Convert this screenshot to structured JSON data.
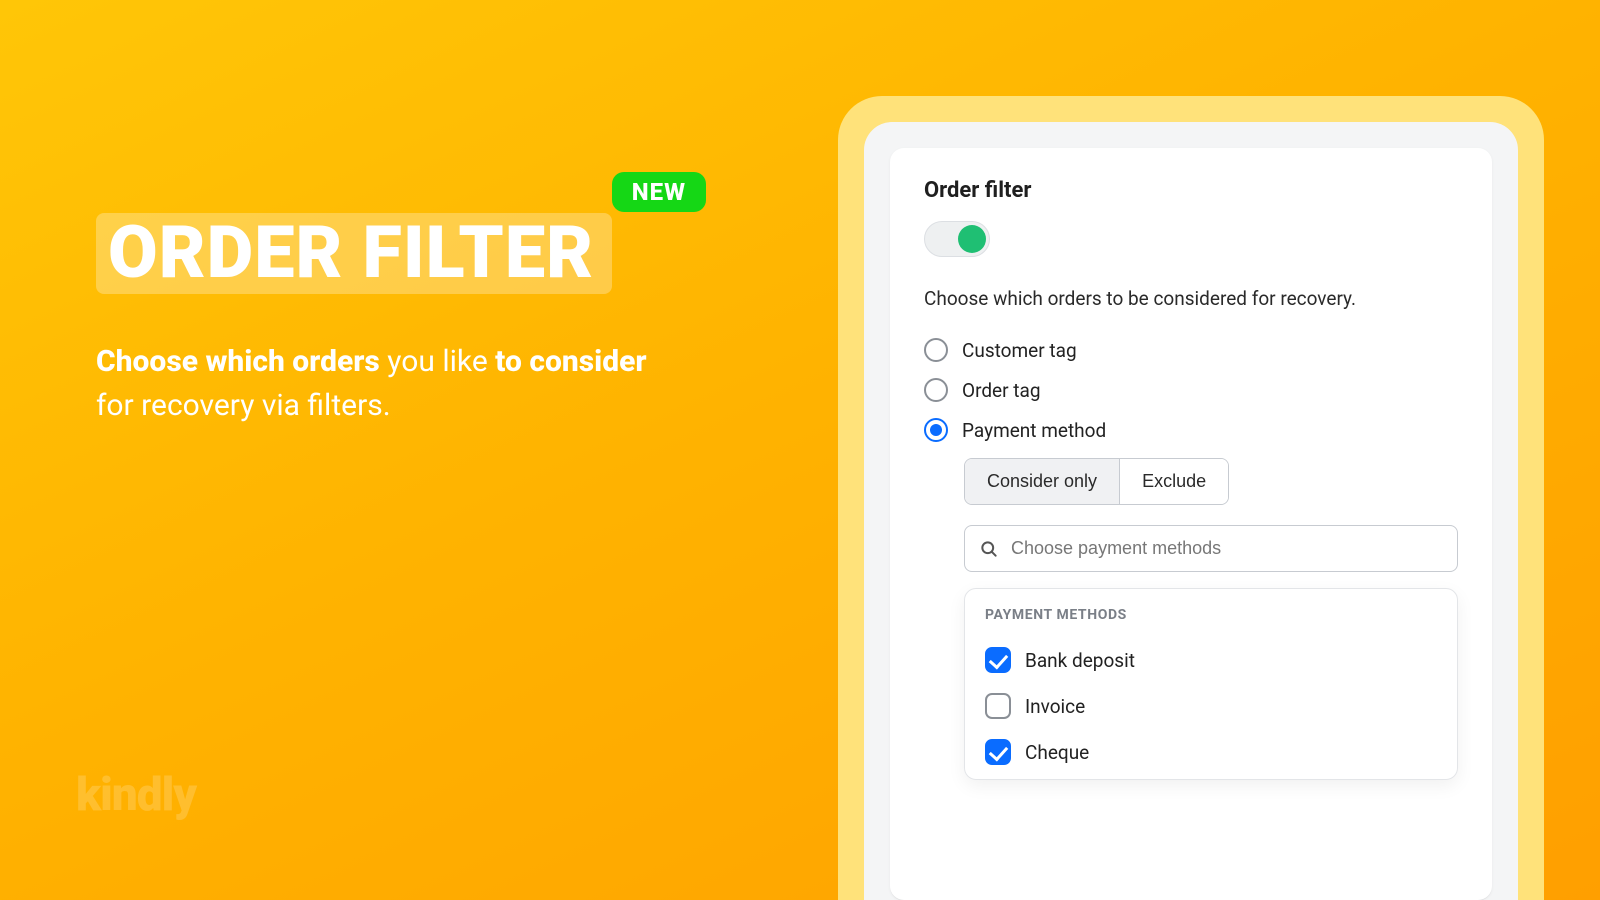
{
  "hero": {
    "badge": "NEW",
    "title": "ORDER FILTER",
    "sub_b1": "Choose which orders",
    "sub_mid": " you like ",
    "sub_b2": "to consider",
    "sub_tail": " for recovery via filters."
  },
  "brand": {
    "name": "kindly",
    "tag": ""
  },
  "card": {
    "title": "Order filter",
    "toggle_on": true,
    "desc": "Choose which orders to be considered for recovery.",
    "radios": [
      {
        "label": "Customer tag",
        "selected": false
      },
      {
        "label": "Order tag",
        "selected": false
      },
      {
        "label": "Payment method",
        "selected": true
      }
    ],
    "segmented": {
      "consider": "Consider only",
      "exclude": "Exclude",
      "active": "consider"
    },
    "search_placeholder": "Choose payment methods",
    "dropdown": {
      "header": "PAYMENT METHODS",
      "options": [
        {
          "label": "Bank deposit",
          "checked": true
        },
        {
          "label": "Invoice",
          "checked": false
        },
        {
          "label": "Cheque",
          "checked": true
        }
      ]
    }
  }
}
